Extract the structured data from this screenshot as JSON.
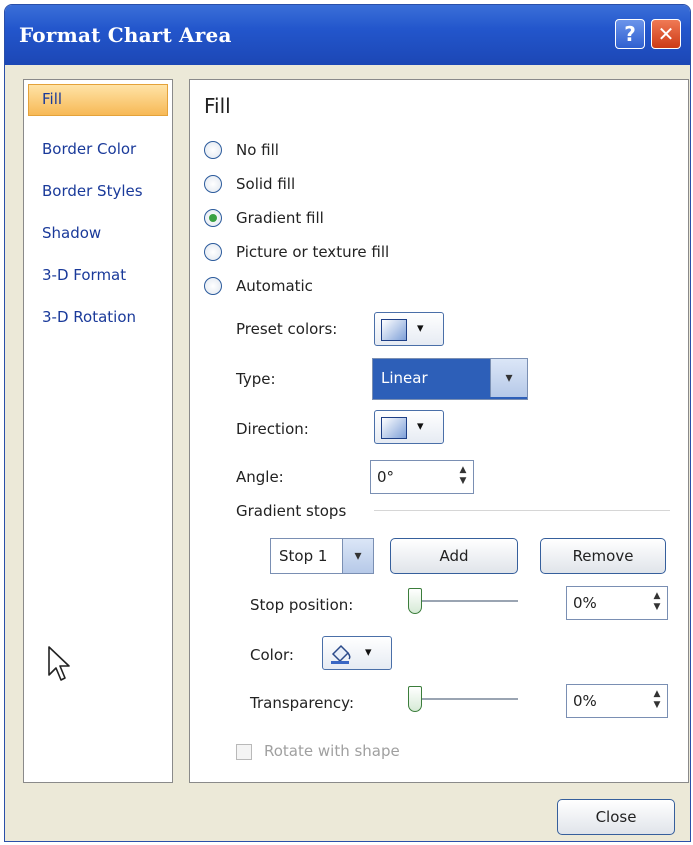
{
  "window": {
    "title": "Format Chart Area",
    "help_label": "?",
    "close_label": "✕"
  },
  "sidebar": {
    "items": [
      {
        "label": "Fill",
        "selected": true
      },
      {
        "label": "Border Color"
      },
      {
        "label": "Border Styles"
      },
      {
        "label": "Shadow"
      },
      {
        "label": "3-D Format"
      },
      {
        "label": "3-D Rotation"
      }
    ]
  },
  "fill": {
    "title": "Fill",
    "options": [
      {
        "label": "No fill",
        "checked": false
      },
      {
        "label": "Solid fill",
        "checked": false
      },
      {
        "label": "Gradient fill",
        "checked": true
      },
      {
        "label": "Picture or texture fill",
        "checked": false
      },
      {
        "label": "Automatic",
        "checked": false
      }
    ],
    "preset_colors_label": "Preset colors:",
    "type_label": "Type:",
    "type_value": "Linear",
    "direction_label": "Direction:",
    "angle_label": "Angle:",
    "angle_value": "0°",
    "gradient_stops_label": "Gradient stops",
    "stop_value": "Stop 1",
    "add_label": "Add",
    "remove_label": "Remove",
    "stop_position_label": "Stop position:",
    "stop_position_value": "0%",
    "color_label": "Color:",
    "transparency_label": "Transparency:",
    "transparency_value": "0%",
    "rotate_label": "Rotate with shape"
  },
  "footer": {
    "close_label": "Close"
  },
  "icons": {
    "dropdown": "▾",
    "spin_up": "▲",
    "spin_down": "▼"
  },
  "colors": {
    "title_bar": "#2356cc",
    "selection": "#f7b956",
    "accent": "#2d5fb8"
  }
}
